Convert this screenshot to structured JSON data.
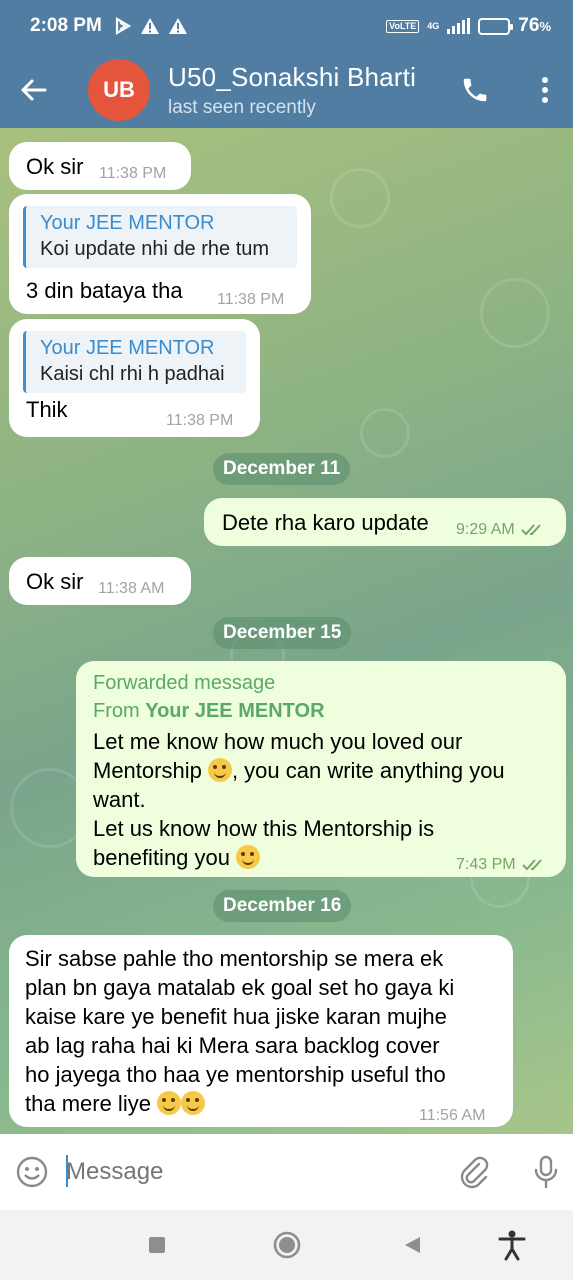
{
  "status_bar": {
    "time": "2:08 PM",
    "battery": "76",
    "battery_unit": "%",
    "network": "4G",
    "volte": "VoLTE",
    "icons": [
      "play-protect-icon",
      "warning-icon",
      "warning-icon",
      "signal-icon",
      "battery-icon"
    ]
  },
  "header": {
    "avatar_initials": "UB",
    "avatar_color": "#e5553b",
    "title": "U50_Sonakshi Bharti",
    "subtitle": "last seen recently"
  },
  "messages": [
    {
      "text": "Ok sir",
      "time": "11:38 PM"
    },
    {
      "reply_name": "Your JEE MENTOR",
      "reply_text": "Koi update nhi de rhe tum",
      "text": "3 din bataya tha",
      "time": "11:38 PM"
    },
    {
      "reply_name": "Your JEE MENTOR",
      "reply_text": "Kaisi chl rhi h padhai",
      "text": "Thik",
      "time": "11:38 PM"
    },
    {
      "date": "December 11"
    },
    {
      "text": "Dete rha karo update",
      "time": "9:29 AM"
    },
    {
      "text": "Ok sir",
      "time": "11:38 AM"
    },
    {
      "date": "December 15"
    },
    {
      "forward_label": "Forwarded message",
      "forward_from_prefix": "From ",
      "forward_from": "Your JEE MENTOR",
      "line1": "Let me know how much you loved our",
      "line2a": "Mentorship ",
      "line2b": ", you can write anything you",
      "line3": "want.",
      "line4": "Let us know how this Mentorship is",
      "line5": "benefiting you ",
      "time": "7:43 PM"
    },
    {
      "date": "December 16"
    },
    {
      "lines": [
        "Sir sabse pahle tho mentorship se mera ek",
        "plan bn gaya matalab ek goal set ho gaya ki",
        "kaise kare ye benefit hua jiske karan mujhe",
        "ab lag raha hai ki Mera sara backlog cover",
        "ho jayega tho haa ye mentorship useful tho",
        "tha mere liye "
      ],
      "time": "11:56 AM"
    }
  ],
  "input": {
    "placeholder": "Message"
  },
  "colors": {
    "header": "#517da2",
    "outgoing_bubble": "#effedd",
    "incoming_bubble": "#ffffff",
    "reply_name": "#3a8ccf",
    "forward_green": "#5aa86a"
  }
}
